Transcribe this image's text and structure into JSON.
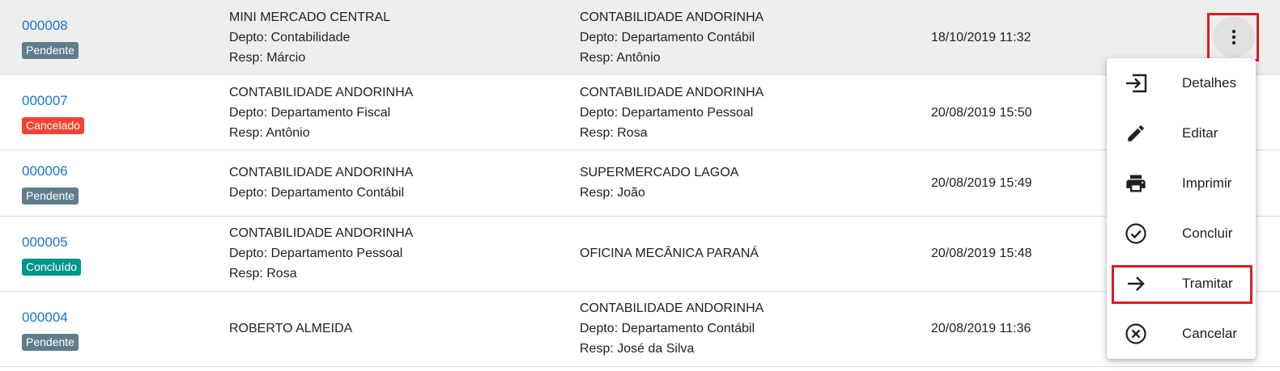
{
  "colors": {
    "link": "#1976d2",
    "pendente": "#607d8b",
    "cancelado": "#f44336",
    "concluido": "#009688",
    "highlight_border": "#e01b24"
  },
  "rows": [
    {
      "id": "000008",
      "status": "Pendente",
      "origin": [
        "MINI MERCADO CENTRAL",
        "Depto: Contabilidade",
        "Resp: Márcio"
      ],
      "dest": [
        "CONTABILIDADE ANDORINHA",
        "Depto: Departamento Contábil",
        "Resp: Antônio"
      ],
      "date": "18/10/2019 11:32"
    },
    {
      "id": "000007",
      "status": "Cancelado",
      "origin": [
        "CONTABILIDADE ANDORINHA",
        "Depto: Departamento Fiscal",
        "Resp: Antônio"
      ],
      "dest": [
        "CONTABILIDADE ANDORINHA",
        "Depto: Departamento Pessoal",
        "Resp: Rosa"
      ],
      "date": "20/08/2019 15:50"
    },
    {
      "id": "000006",
      "status": "Pendente",
      "origin": [
        "CONTABILIDADE ANDORINHA",
        "Depto: Departamento Contábil"
      ],
      "dest": [
        "SUPERMERCADO LAGOA",
        "Resp: João"
      ],
      "date": "20/08/2019 15:49"
    },
    {
      "id": "000005",
      "status": "Concluído",
      "origin": [
        "CONTABILIDADE ANDORINHA",
        "Depto: Departamento Pessoal",
        "Resp: Rosa"
      ],
      "dest": [
        "OFICINA MECÂNICA PARANÁ"
      ],
      "date": "20/08/2019 15:48"
    },
    {
      "id": "000004",
      "status": "Pendente",
      "origin": [
        "ROBERTO ALMEIDA"
      ],
      "dest": [
        "CONTABILIDADE ANDORINHA",
        "Depto: Departamento Contábil",
        "Resp: José da Silva"
      ],
      "date": "20/08/2019 11:36"
    }
  ],
  "menu_button": {
    "icon": "more-vert-icon"
  },
  "menu": {
    "items": [
      {
        "label": "Detalhes",
        "icon": "details-enter-icon"
      },
      {
        "label": "Editar",
        "icon": "pencil-icon"
      },
      {
        "label": "Imprimir",
        "icon": "printer-icon"
      },
      {
        "label": "Concluir",
        "icon": "check-circle-icon"
      },
      {
        "label": "Tramitar",
        "icon": "arrow-right-icon"
      },
      {
        "label": "Cancelar",
        "icon": "cancel-circle-icon"
      }
    ]
  }
}
